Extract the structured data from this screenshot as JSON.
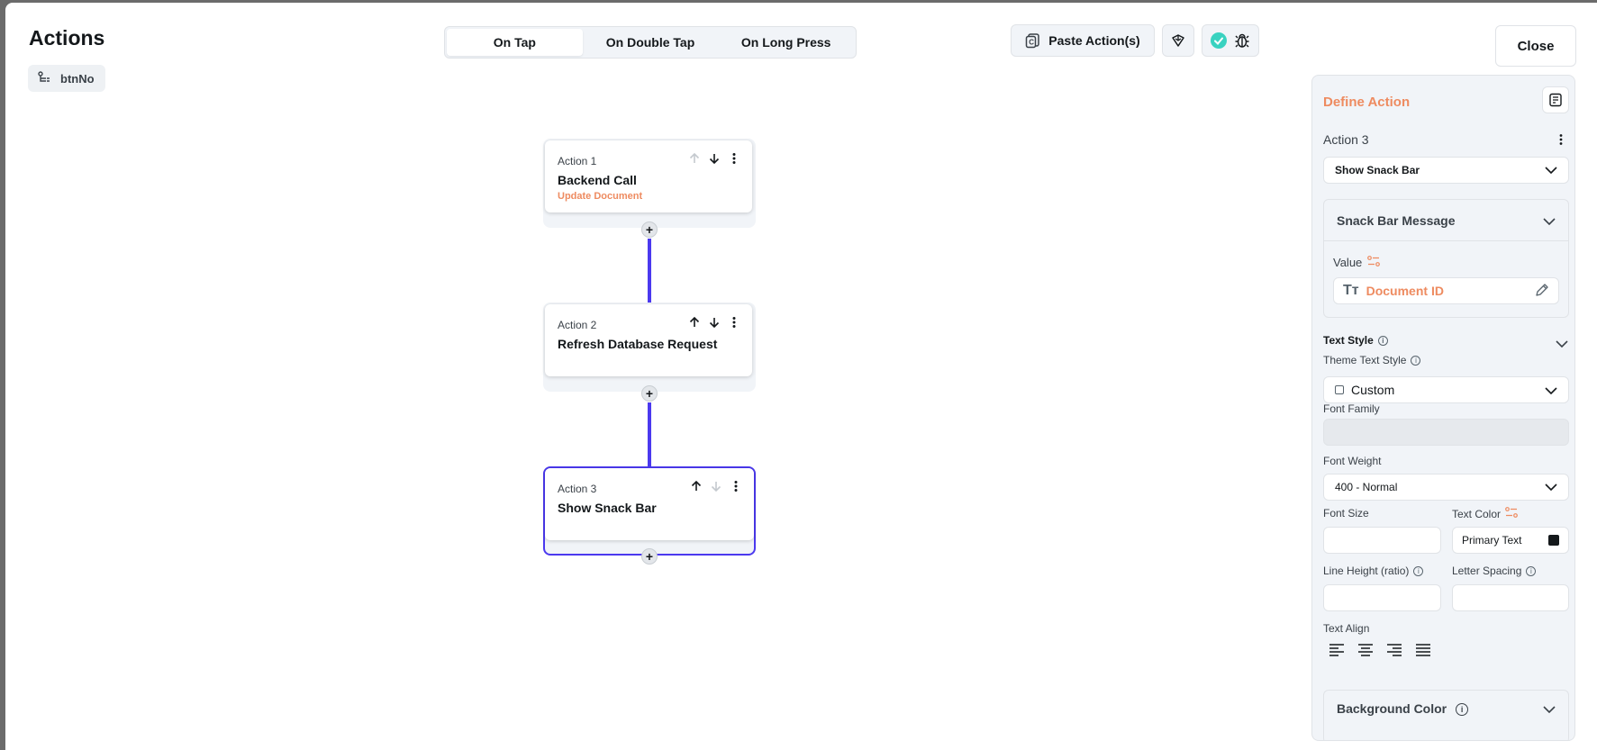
{
  "header": {
    "title": "Actions",
    "chip_label": "btnNo",
    "close_label": "Close",
    "paste_label": "Paste Action(s)"
  },
  "tabs": [
    {
      "label": "On Tap",
      "active": true
    },
    {
      "label": "On Double Tap",
      "active": false
    },
    {
      "label": "On Long Press",
      "active": false
    }
  ],
  "actions": [
    {
      "index_label": "Action 1",
      "name": "Backend Call",
      "subtitle": "Update Document"
    },
    {
      "index_label": "Action 2",
      "name": "Refresh Database Request",
      "subtitle": ""
    },
    {
      "index_label": "Action 3",
      "name": "Show Snack Bar",
      "subtitle": "",
      "selected": true
    }
  ],
  "panel": {
    "title": "Define Action",
    "action_label": "Action 3",
    "action_type": "Show Snack Bar",
    "message_section": "Snack Bar Message",
    "value_label": "Value",
    "value": "Document ID",
    "text_style_label": "Text Style",
    "theme_text_style_label": "Theme Text Style",
    "theme_text_style_value": "Custom",
    "font_family_label": "Font Family",
    "font_weight_label": "Font Weight",
    "font_weight_value": "400 - Normal",
    "font_size_label": "Font Size",
    "text_color_label": "Text Color",
    "text_color_value": "Primary Text",
    "line_height_label": "Line Height (ratio)",
    "letter_spacing_label": "Letter Spacing",
    "text_align_label": "Text Align",
    "background_color_label": "Background Color"
  },
  "colors": {
    "accent": "#4b39ef",
    "orange": "#ee8b60",
    "success": "#39d2c0"
  },
  "icons": [
    "tree-icon",
    "paste-icon",
    "magic-icon",
    "check-circle-icon",
    "bug-icon",
    "arrow-up-icon",
    "arrow-down-icon",
    "kebab-icon",
    "plus-icon",
    "notes-icon",
    "chevron-down-icon",
    "variable-icon",
    "text-type-icon",
    "pencil-icon",
    "info-icon",
    "align-left-icon",
    "align-center-icon",
    "align-right-icon",
    "align-justify-icon"
  ]
}
